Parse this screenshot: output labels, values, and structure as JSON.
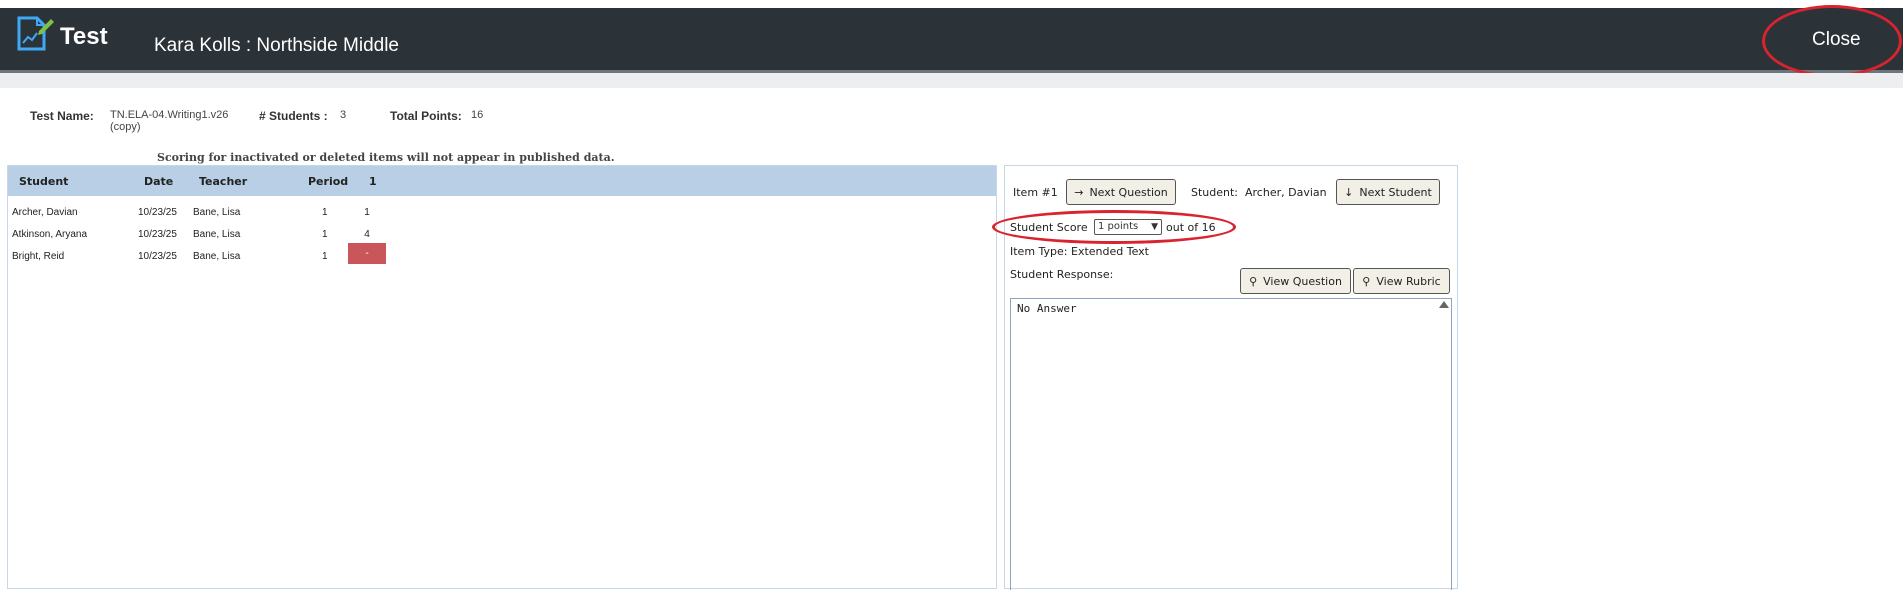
{
  "header": {
    "app_title": "Test",
    "user_school": "Kara Kolls : Northside Middle",
    "close_label": "Close",
    "logo_icon": "document-edit-icon"
  },
  "test_info": {
    "name_label": "Test Name:",
    "name_value_line1": "TN.ELA-04.Writing1.v26",
    "name_value_line2": "(copy)",
    "students_label": "# Students :",
    "students_value": "3",
    "points_label": "Total Points:",
    "points_value": "16"
  },
  "notice": "Scoring for inactivated or deleted items will not appear in published data.",
  "table": {
    "headers": [
      "Student",
      "Date",
      "Teacher",
      "Period",
      "1"
    ],
    "rows": [
      {
        "student": "Archer, Davian",
        "date": "10/23/25",
        "teacher": "Bane, Lisa",
        "period": "1",
        "score": "1"
      },
      {
        "student": "Atkinson, Aryana",
        "date": "10/23/25",
        "teacher": "Bane, Lisa",
        "period": "1",
        "score": "4"
      },
      {
        "student": "Bright, Reid",
        "date": "10/23/25",
        "teacher": "Bane, Lisa",
        "period": "1",
        "score": "-"
      }
    ]
  },
  "scoring": {
    "item_label": "Item #1",
    "next_question": "Next Question",
    "student_label": "Student:",
    "student_name": "Archer, Davian",
    "next_student": "Next Student",
    "score_label": "Student Score",
    "score_selected": "1 points",
    "score_out_of": "out of 16",
    "item_type": "Item Type: Extended Text",
    "response_label": "Student Response:",
    "view_question": "View Question",
    "view_rubric": "View Rubric",
    "response_text": "No Answer"
  },
  "colors": {
    "header_bg": "#2b3238",
    "table_header_bg": "#b8cfe6",
    "missing_score_bg": "#c9565a",
    "highlight_ring": "#d9232e"
  }
}
